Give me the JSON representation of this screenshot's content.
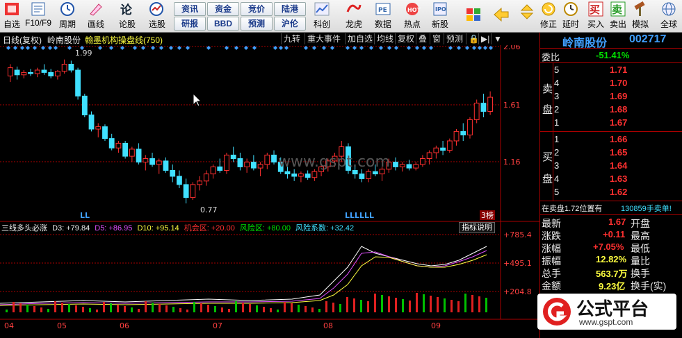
{
  "toolbar": {
    "items": [
      {
        "label": "自选",
        "icon": "grid-icon"
      },
      {
        "label": "F10/F9",
        "icon": "f10-icon"
      },
      {
        "label": "周期",
        "icon": "clock-icon"
      },
      {
        "label": "画线",
        "icon": "pen-icon"
      },
      {
        "label": "论股",
        "icon": "forum-icon"
      },
      {
        "label": "选股",
        "icon": "select-stock-icon"
      }
    ],
    "text_buttons": [
      "资讯",
      "资金",
      "竞价",
      "陆港",
      "研报",
      "BBD",
      "预测",
      "沪伦"
    ],
    "right_items": [
      {
        "label": "科创"
      },
      {
        "label": "龙虎"
      },
      {
        "label": "数据"
      },
      {
        "label": "热点"
      },
      {
        "label": "新股"
      }
    ],
    "far_right": [
      {
        "label": "修正"
      },
      {
        "label": "延时"
      },
      {
        "label": "买入"
      },
      {
        "label": "卖出"
      },
      {
        "label": "模拟"
      },
      {
        "label": "全球"
      }
    ]
  },
  "chart_header": {
    "period": "日线(复权)",
    "stock": "岭南股份",
    "indicator": "翰墨机构操盘线(750)",
    "buttons": [
      "九转",
      "重大事件",
      "加自选",
      "均线",
      "复权",
      "叠",
      "窗",
      "预测"
    ]
  },
  "price_axis": [
    "2.06",
    "1.61",
    "1.16"
  ],
  "annotations": {
    "high": "1.99",
    "low": "0.77",
    "ll1": "LL",
    "ll2": "LLLLLL",
    "badge": "3榜"
  },
  "indicator_header": {
    "name": "三线多头必涨",
    "d3": "D3: +79.84",
    "d5": "D5: +86.95",
    "d10": "D10: +95.14",
    "chance": "机会区: +20.00",
    "risk": "风险区: +80.00",
    "coef": "风险系数: +32.42",
    "explain": "指标说明"
  },
  "indicator_axis": [
    "+785.4",
    "+495.1",
    "+204.8"
  ],
  "months": [
    "04",
    "05",
    "06",
    "07",
    "08",
    "09"
  ],
  "watermark_text": "www.gspt.com",
  "panel": {
    "name": "岭南股份",
    "code": "002717",
    "weibi_label": "委比",
    "weibi": "-51.41%",
    "sell_label": [
      "卖",
      "盘"
    ],
    "buy_label": [
      "买",
      "盘"
    ],
    "sells": [
      [
        "5",
        "1.71"
      ],
      [
        "4",
        "1.70"
      ],
      [
        "3",
        "1.69"
      ],
      [
        "2",
        "1.68"
      ],
      [
        "1",
        "1.67"
      ]
    ],
    "buys": [
      [
        "1",
        "1.66"
      ],
      [
        "2",
        "1.65"
      ],
      [
        "3",
        "1.64"
      ],
      [
        "4",
        "1.63"
      ],
      [
        "5",
        "1.62"
      ]
    ],
    "notice_left": "在卖盘1.72位置有",
    "notice_right": "130859手卖单!",
    "stats": [
      {
        "l": "最新",
        "v": "1.67",
        "r": "开盘"
      },
      {
        "l": "涨跌",
        "v": "+0.11",
        "r": "最高"
      },
      {
        "l": "涨幅",
        "v": "+7.05%",
        "r": "最低"
      },
      {
        "l": "振幅",
        "v": "12.82%",
        "r": "量比"
      },
      {
        "l": "总手",
        "v": "563.7万",
        "r": "换手"
      },
      {
        "l": "金额",
        "v": "9.23亿",
        "r": "换手(实)"
      }
    ],
    "logo_text": "公式平台",
    "logo_url": "www.gspt.com"
  },
  "chart_data": {
    "type": "candlestick",
    "price_range": [
      0.7,
      2.1
    ],
    "candles": [
      [
        1.85,
        1.95,
        1.8,
        1.92
      ],
      [
        1.9,
        1.93,
        1.82,
        1.86
      ],
      [
        1.86,
        1.9,
        1.83,
        1.88
      ],
      [
        1.88,
        1.91,
        1.85,
        1.87
      ],
      [
        1.87,
        1.92,
        1.84,
        1.9
      ],
      [
        1.9,
        1.95,
        1.86,
        1.88
      ],
      [
        1.88,
        1.91,
        1.83,
        1.85
      ],
      [
        1.85,
        1.9,
        1.82,
        1.89
      ],
      [
        1.89,
        1.99,
        1.87,
        1.95
      ],
      [
        1.95,
        1.98,
        1.88,
        1.9
      ],
      [
        1.9,
        1.92,
        1.65,
        1.68
      ],
      [
        1.68,
        1.7,
        1.5,
        1.52
      ],
      [
        1.52,
        1.55,
        1.38,
        1.4
      ],
      [
        1.4,
        1.45,
        1.33,
        1.42
      ],
      [
        1.42,
        1.44,
        1.3,
        1.32
      ],
      [
        1.32,
        1.36,
        1.22,
        1.24
      ],
      [
        1.24,
        1.3,
        1.2,
        1.28
      ],
      [
        1.28,
        1.3,
        1.15,
        1.17
      ],
      [
        1.17,
        1.25,
        1.12,
        1.23
      ],
      [
        1.23,
        1.28,
        1.1,
        1.12
      ],
      [
        1.12,
        1.18,
        1.05,
        1.15
      ],
      [
        1.15,
        1.2,
        1.08,
        1.1
      ],
      [
        1.1,
        1.15,
        1.02,
        1.13
      ],
      [
        1.13,
        1.16,
        1.03,
        1.05
      ],
      [
        1.05,
        1.1,
        0.95,
        1.0
      ],
      [
        1.0,
        1.05,
        0.9,
        0.93
      ],
      [
        0.93,
        0.98,
        0.77,
        0.82
      ],
      [
        0.82,
        0.95,
        0.8,
        0.93
      ],
      [
        0.93,
        1.0,
        0.88,
        0.96
      ],
      [
        0.96,
        1.05,
        0.92,
        1.02
      ],
      [
        1.02,
        1.1,
        0.98,
        1.08
      ],
      [
        1.08,
        1.15,
        1.03,
        1.05
      ],
      [
        1.05,
        1.2,
        1.02,
        1.18
      ],
      [
        1.18,
        1.25,
        1.12,
        1.15
      ],
      [
        1.15,
        1.2,
        1.05,
        1.08
      ],
      [
        1.08,
        1.15,
        1.03,
        1.12
      ],
      [
        1.12,
        1.18,
        1.05,
        1.07
      ],
      [
        1.07,
        1.12,
        1.0,
        1.1
      ],
      [
        1.1,
        1.2,
        1.06,
        1.18
      ],
      [
        1.18,
        1.22,
        1.1,
        1.12
      ],
      [
        1.12,
        1.16,
        1.02,
        1.04
      ],
      [
        1.04,
        1.08,
        0.98,
        1.02
      ],
      [
        1.02,
        1.06,
        0.96,
        1.0
      ],
      [
        1.0,
        1.04,
        0.95,
        1.02
      ],
      [
        1.02,
        1.05,
        0.97,
        0.99
      ],
      [
        0.99,
        1.06,
        0.96,
        1.04
      ],
      [
        1.04,
        1.1,
        1.0,
        1.08
      ],
      [
        1.08,
        1.15,
        1.04,
        1.13
      ],
      [
        1.13,
        1.2,
        1.08,
        1.17
      ],
      [
        1.17,
        1.3,
        1.12,
        1.25
      ],
      [
        1.25,
        1.28,
        1.02,
        1.05
      ],
      [
        1.05,
        1.1,
        0.98,
        1.02
      ],
      [
        1.02,
        1.06,
        0.95,
        0.98
      ],
      [
        0.98,
        1.06,
        0.95,
        1.04
      ],
      [
        1.04,
        1.1,
        1.0,
        1.02
      ],
      [
        1.02,
        1.08,
        0.96,
        1.06
      ],
      [
        1.06,
        1.15,
        1.03,
        1.12
      ],
      [
        1.12,
        1.16,
        1.05,
        1.08
      ],
      [
        1.08,
        1.12,
        1.04,
        1.1
      ],
      [
        1.1,
        1.14,
        1.05,
        1.07
      ],
      [
        1.07,
        1.12,
        1.05,
        1.1
      ],
      [
        1.1,
        1.18,
        1.08,
        1.15
      ],
      [
        1.15,
        1.22,
        1.1,
        1.2
      ],
      [
        1.2,
        1.26,
        1.15,
        1.24
      ],
      [
        1.24,
        1.3,
        1.18,
        1.22
      ],
      [
        1.22,
        1.32,
        1.2,
        1.3
      ],
      [
        1.3,
        1.4,
        1.26,
        1.38
      ],
      [
        1.38,
        1.45,
        1.3,
        1.35
      ],
      [
        1.35,
        1.5,
        1.32,
        1.48
      ],
      [
        1.48,
        1.65,
        1.45,
        1.62
      ],
      [
        1.62,
        1.7,
        1.5,
        1.55
      ],
      [
        1.55,
        1.72,
        1.52,
        1.67
      ]
    ]
  }
}
